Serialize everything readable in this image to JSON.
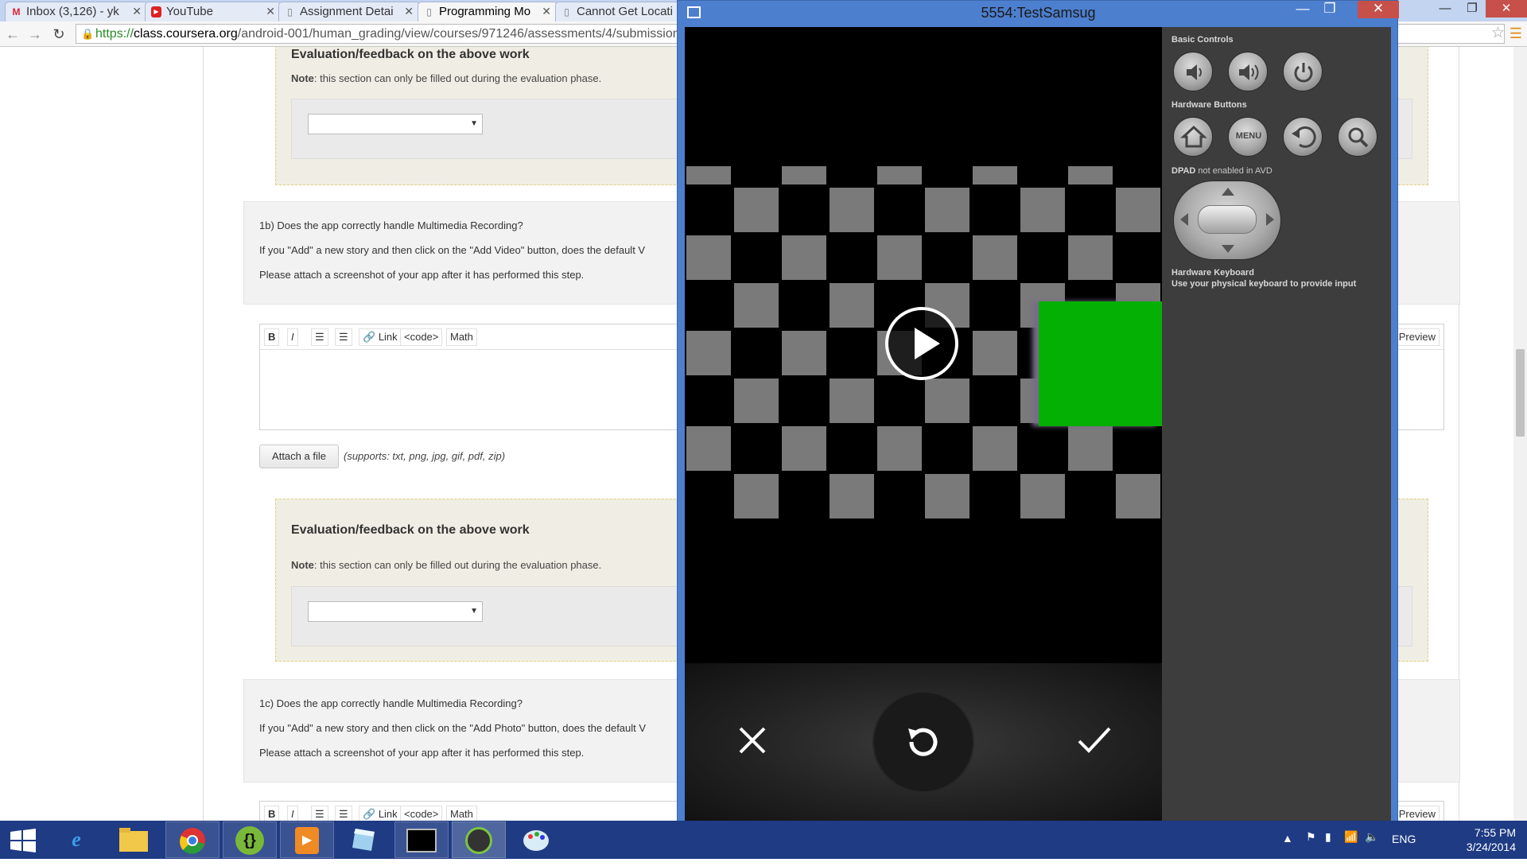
{
  "browser": {
    "tabs": [
      {
        "label": "Inbox (3,126) - yk",
        "icon": "gmail-icon"
      },
      {
        "label": "YouTube",
        "icon": "youtube-icon"
      },
      {
        "label": "Assignment Detai",
        "icon": "page-icon"
      },
      {
        "label": "Programming Mo",
        "icon": "page-icon"
      },
      {
        "label": "Cannot Get Locati",
        "icon": "page-icon"
      }
    ],
    "active_tab": 3,
    "url_scheme": "https://",
    "url_host": "class.coursera.org",
    "url_path": "/android-001/human_grading/view/courses/971246/assessments/4/submission"
  },
  "page": {
    "eval1": {
      "title": "Evaluation/feedback on the above work",
      "note_bold": "Note",
      "note_text": ": this section can only be filled out during the evaluation phase."
    },
    "q1b": {
      "question": "1b) Does the app correctly handle Multimedia Recording?",
      "detail": "If you \"Add\" a new story and then click on the \"Add Video\" button, does the default V",
      "instruction": "Please attach a screenshot of your app after it has performed this step."
    },
    "editor": {
      "bold": "B",
      "italic": "I",
      "ul": "☰",
      "ol": "☰",
      "link": "Link",
      "code": "<code>",
      "math": "Math",
      "preview": "Preview"
    },
    "attach": {
      "button": "Attach a file",
      "note": "(supports: txt, png, jpg, gif, pdf, zip)"
    },
    "eval2": {
      "title": "Evaluation/feedback on the above work",
      "note_bold": "Note",
      "note_text": ": this section can only be filled out during the evaluation phase."
    },
    "q1c": {
      "question": "1c) Does the app correctly handle Multimedia Recording?",
      "detail": "If you \"Add\" a new story and then click on the \"Add Photo\" button, does the default V",
      "instruction": "Please attach a screenshot of your app after it has performed this step."
    }
  },
  "emulator": {
    "title": "5554:TestSamsug",
    "panel": {
      "basic_controls": "Basic Controls",
      "hardware_buttons": "Hardware Buttons",
      "menu_label": "MENU",
      "dpad_label_bold": "DPAD",
      "dpad_label_rest": " not enabled in AVD",
      "keyboard_title": "Hardware Keyboard",
      "keyboard_desc": "Use your physical keyboard to provide input"
    },
    "colors": {
      "green_box": "#05b005",
      "checker_gray": "#7a7a7a"
    }
  },
  "taskbar": {
    "language": "ENG",
    "time": "7:55 PM",
    "date": "3/24/2014"
  }
}
